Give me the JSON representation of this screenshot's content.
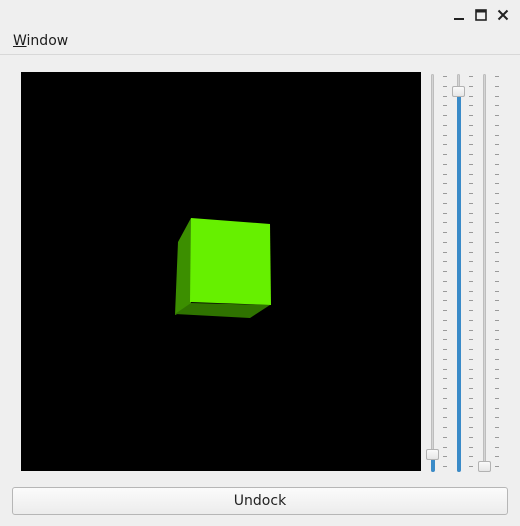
{
  "window": {
    "menu": {
      "label_mnemonic": "W",
      "label_rest": "indow"
    },
    "controls": {
      "minimize_icon": "minimize-icon",
      "maximize_icon": "maximize-icon",
      "close_icon": "close-icon"
    }
  },
  "scene": {
    "background": "#000000",
    "cube_front_color": "#66f000",
    "cube_side_color": "#3c8f00",
    "cube_bottom_color": "#2f7300"
  },
  "sliders": [
    {
      "name": "x-rotation",
      "level": 0.03
    },
    {
      "name": "y-rotation",
      "level": 0.97
    },
    {
      "name": "z-rotation",
      "level": 0.0
    }
  ],
  "accent_color": "#3a8bc8",
  "undock_button": {
    "label": "Undock"
  }
}
